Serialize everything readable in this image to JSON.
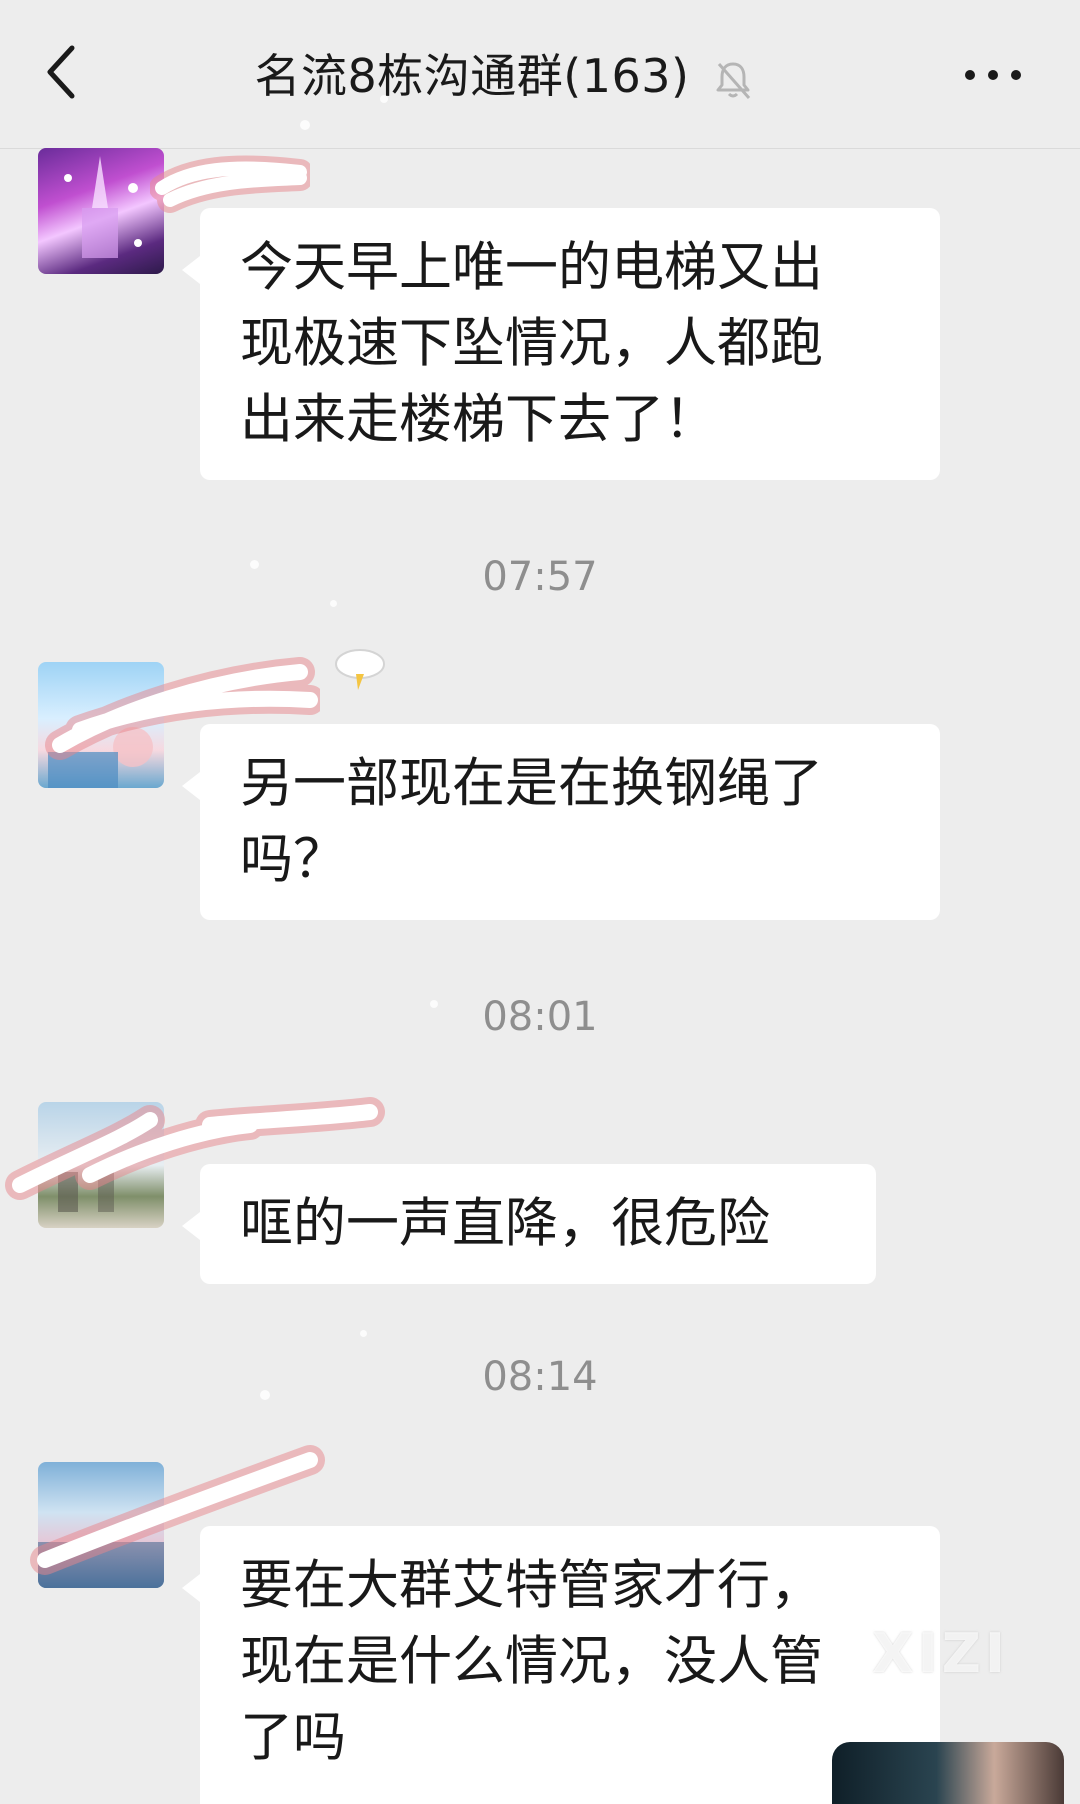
{
  "header": {
    "title": "名流8栋沟通群(163)",
    "back_icon": "chevron-left-icon",
    "mute_icon": "bell-off-icon",
    "more_icon": "more-dots-icon"
  },
  "messages": [
    {
      "lines": [
        "今天早上唯一的电梯又出",
        "现极速下坠情况，人都跑",
        "出来走楼梯下去了！"
      ]
    },
    {
      "lines": [
        "另一部现在是在换钢绳了",
        "吗？"
      ]
    },
    {
      "lines": [
        "哐的一声直降，很危险"
      ]
    },
    {
      "lines": [
        "要在大群艾特管家才行，",
        "现在是什么情况，没人管",
        "了吗"
      ]
    }
  ],
  "timestamps": [
    "07:57",
    "08:01",
    "08:14"
  ],
  "watermark": "XIZI",
  "colors": {
    "background": "#ededed",
    "bubble": "#ffffff",
    "timestamp": "#8e8e8e",
    "redaction": "#e8868c"
  }
}
